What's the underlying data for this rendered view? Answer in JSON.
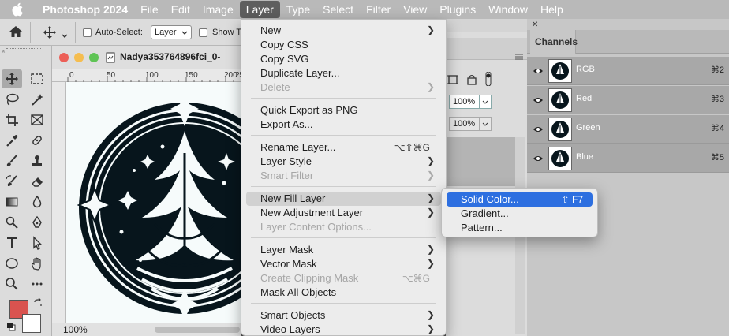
{
  "menubar": {
    "items": [
      "Photoshop 2024",
      "File",
      "Edit",
      "Image",
      "Layer",
      "Type",
      "Select",
      "Filter",
      "View",
      "Plugins",
      "Window",
      "Help"
    ],
    "active": "Layer"
  },
  "options_bar": {
    "auto_select_label": "Auto-Select:",
    "auto_select_value": "Layer",
    "show_transform_label": "Show T"
  },
  "document": {
    "tab_title": "Nadya353764896fci_0-",
    "ruler_marks": [
      "0",
      "50",
      "100",
      "150",
      "200",
      "25"
    ],
    "zoom": "100%"
  },
  "hidden_panel": {
    "opacity": "100%",
    "fill": "100%"
  },
  "channels_panel": {
    "title": "Channels",
    "channels": [
      {
        "name": "RGB",
        "shortcut": "⌘2"
      },
      {
        "name": "Red",
        "shortcut": "⌘3"
      },
      {
        "name": "Green",
        "shortcut": "⌘4"
      },
      {
        "name": "Blue",
        "shortcut": "⌘5"
      }
    ]
  },
  "layer_menu": {
    "items": [
      {
        "label": "New",
        "submenu": true,
        "disabled": false
      },
      {
        "label": "Copy CSS",
        "disabled": false
      },
      {
        "label": "Copy SVG",
        "disabled": false
      },
      {
        "label": "Duplicate Layer...",
        "disabled": false
      },
      {
        "label": "Delete",
        "submenu": true,
        "disabled": true
      },
      {
        "label": "Quick Export as PNG",
        "disabled": false
      },
      {
        "label": "Export As...",
        "disabled": false
      },
      {
        "label": "Rename Layer...",
        "shortcut": "⌥⇧⌘G",
        "disabled": false
      },
      {
        "label": "Layer Style",
        "submenu": true,
        "disabled": false
      },
      {
        "label": "Smart Filter",
        "submenu": true,
        "disabled": true
      },
      {
        "label": "New Fill Layer",
        "submenu": true,
        "disabled": false,
        "highlighted": true
      },
      {
        "label": "New Adjustment Layer",
        "submenu": true,
        "disabled": false
      },
      {
        "label": "Layer Content Options...",
        "disabled": true
      },
      {
        "label": "Layer Mask",
        "submenu": true,
        "disabled": false
      },
      {
        "label": "Vector Mask",
        "submenu": true,
        "disabled": false
      },
      {
        "label": "Create Clipping Mask",
        "shortcut": "⌥⌘G",
        "disabled": true
      },
      {
        "label": "Mask All Objects",
        "disabled": false
      },
      {
        "label": "Smart Objects",
        "submenu": true,
        "disabled": false
      },
      {
        "label": "Video Layers",
        "submenu": true,
        "disabled": false
      }
    ]
  },
  "fill_submenu": {
    "items": [
      {
        "label": "Solid Color...",
        "shortcut": "⇧ F7",
        "selected": true
      },
      {
        "label": "Gradient..."
      },
      {
        "label": "Pattern..."
      }
    ]
  },
  "colors": {
    "foreground": "#d9534f",
    "background": "#ffffff",
    "selection": "#2d6fe0"
  }
}
